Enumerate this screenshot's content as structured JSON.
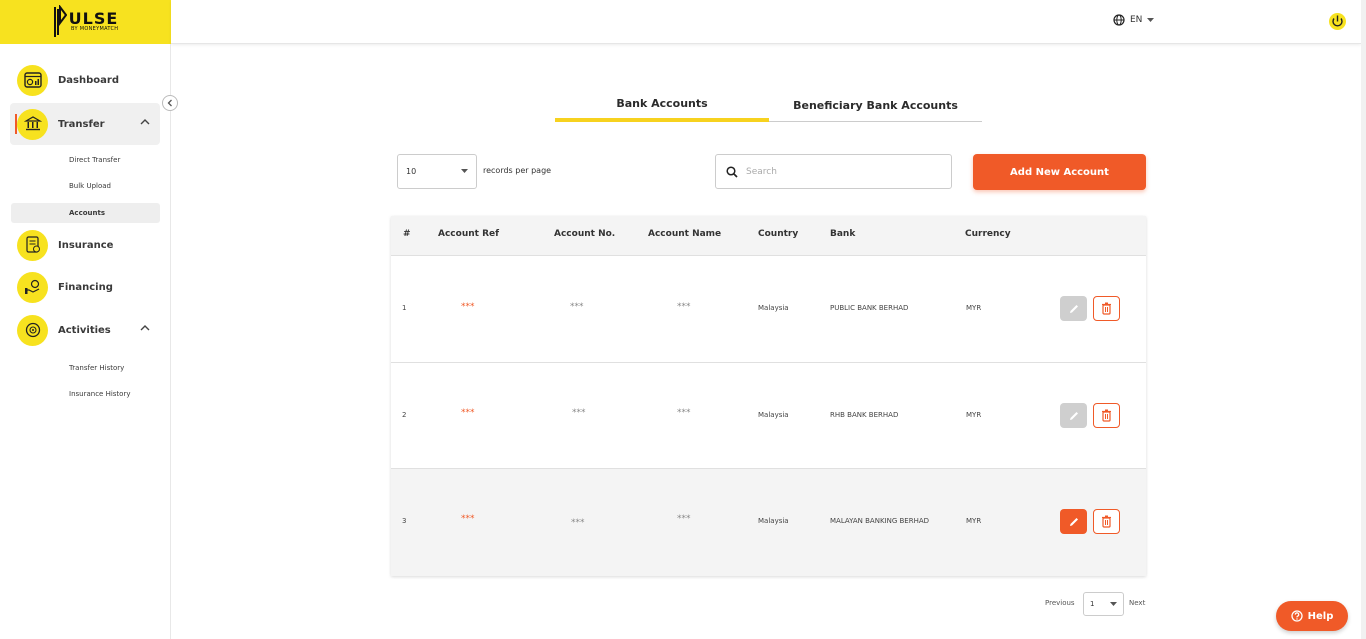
{
  "brand": {
    "name": "ULSE",
    "tagline": "BY MONEYMATCH"
  },
  "header": {
    "language": "EN"
  },
  "sidebar": {
    "items": [
      {
        "label": "Dashboard"
      },
      {
        "label": "Transfer"
      },
      {
        "label": "Insurance"
      },
      {
        "label": "Financing"
      },
      {
        "label": "Activities"
      }
    ],
    "transfer_sub": [
      "Direct Transfer",
      "Bulk Upload",
      "Accounts"
    ],
    "activities_sub": [
      "Transfer History",
      "Insurance History"
    ]
  },
  "tabs": [
    "Bank Accounts",
    "Beneficiary Bank Accounts"
  ],
  "controls": {
    "records_value": "10",
    "records_label": "records per page",
    "search_placeholder": "Search",
    "add_button": "Add New Account"
  },
  "table": {
    "headers": [
      "#",
      "Account Ref",
      "Account No.",
      "Account Name",
      "Country",
      "Bank",
      "Currency"
    ],
    "rows": [
      {
        "num": "1",
        "ref": "***",
        "no": "***",
        "name": "***",
        "country": "Malaysia",
        "bank": "PUBLIC BANK BERHAD",
        "currency": "MYR"
      },
      {
        "num": "2",
        "ref": "***",
        "no": "***",
        "name": "***",
        "country": "Malaysia",
        "bank": "RHB BANK BERHAD",
        "currency": "MYR"
      },
      {
        "num": "3",
        "ref": "***",
        "no": "***",
        "name": "***",
        "country": "Malaysia",
        "bank": "MALAYAN BANKING BERHAD",
        "currency": "MYR"
      }
    ]
  },
  "pagination": {
    "prev": "Previous",
    "page": "1",
    "next": "Next"
  },
  "help": {
    "label": "Help"
  },
  "colors": {
    "brand_yellow": "#f7e21f",
    "accent_orange": "#f05a28"
  }
}
